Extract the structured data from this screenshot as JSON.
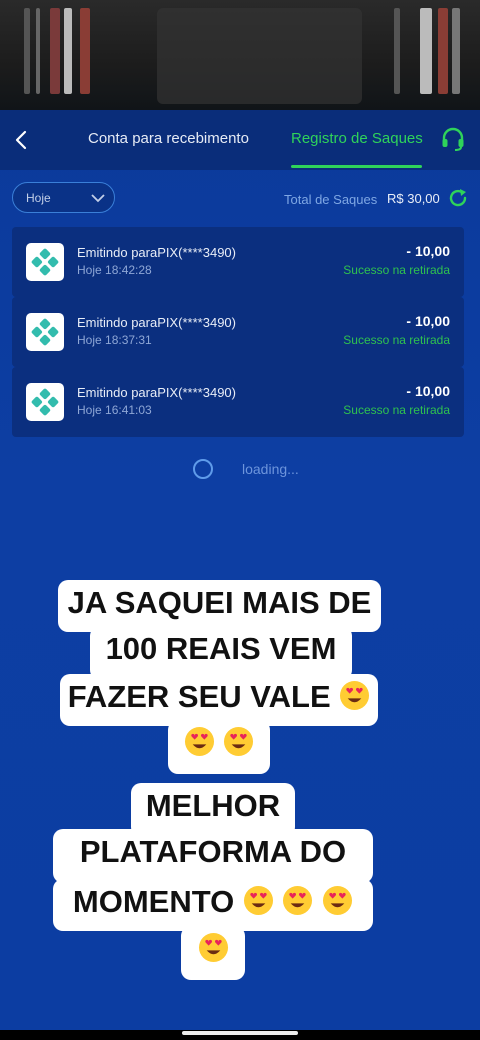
{
  "header": {
    "tab_receive": "Conta para recebimento",
    "tab_withdrawals": "Registro de Saques"
  },
  "filter": {
    "selected": "Hoje"
  },
  "summary": {
    "total_label": "Total de Saques",
    "total_value": "R$ 30,00"
  },
  "records": [
    {
      "title": "Emitindo paraPIX(****3490)",
      "time": "Hoje 18:42:28",
      "amount": "- 10,00",
      "status": "Sucesso na retirada"
    },
    {
      "title": "Emitindo paraPIX(****3490)",
      "time": "Hoje 18:37:31",
      "amount": "- 10,00",
      "status": "Sucesso na retirada"
    },
    {
      "title": "Emitindo paraPIX(****3490)",
      "time": "Hoje 16:41:03",
      "amount": "- 10,00",
      "status": "Sucesso na retirada"
    }
  ],
  "loading_text": "loading...",
  "captions": {
    "first": [
      "JA SAQUEI MAIS DE",
      "100 REAIS VEM",
      "FAZER SEU VALE"
    ],
    "second": [
      "MELHOR",
      "PLATAFORMA DO",
      "MOMENTO"
    ]
  },
  "colors": {
    "accent": "#2fd35a",
    "background": "#0c3da2",
    "card": "#0b2f7f"
  },
  "icons": [
    "back-arrow-icon",
    "headset-icon",
    "chevron-down-icon",
    "refresh-icon",
    "pix-logo-icon",
    "heart-eyes-emoji-icon"
  ]
}
